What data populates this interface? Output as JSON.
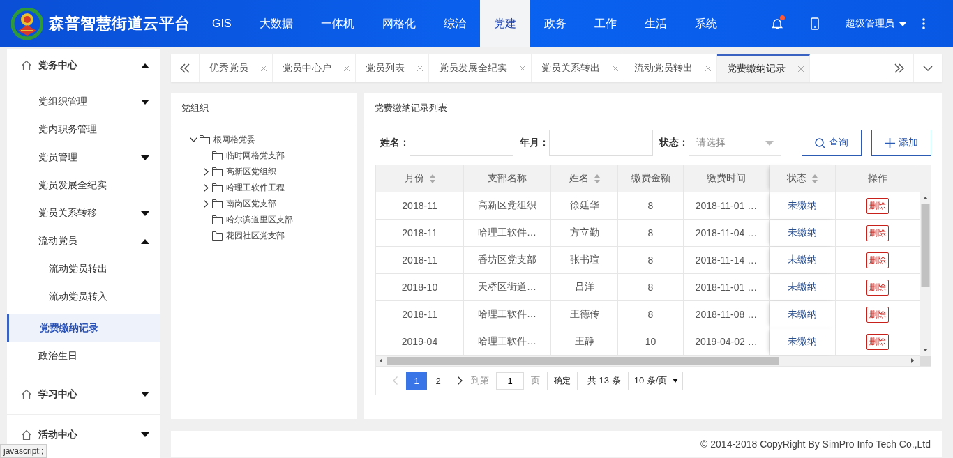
{
  "header": {
    "title": "森普智慧街道云平台",
    "nav": [
      {
        "label": "GIS",
        "selected": false
      },
      {
        "label": "大数据",
        "selected": false
      },
      {
        "label": "一体机",
        "selected": false
      },
      {
        "label": "网格化",
        "selected": false
      },
      {
        "label": "综治",
        "selected": false
      },
      {
        "label": "党建",
        "selected": true
      },
      {
        "label": "政务",
        "selected": false
      },
      {
        "label": "工作",
        "selected": false
      },
      {
        "label": "生活",
        "selected": false
      },
      {
        "label": "系统",
        "selected": false
      }
    ],
    "notifications": {
      "unread": true
    },
    "user": "超级管理员"
  },
  "sidebar": {
    "groups": [
      {
        "label": "党务中心",
        "expanded": true,
        "items": [
          {
            "label": "党组织管理",
            "kind": "submenu",
            "expanded": false,
            "selected": false
          },
          {
            "label": "党内职务管理",
            "kind": "link",
            "selected": false
          },
          {
            "label": "党员管理",
            "kind": "submenu",
            "expanded": false,
            "selected": false
          },
          {
            "label": "党员发展全纪实",
            "kind": "link",
            "selected": false
          },
          {
            "label": "党员关系转移",
            "kind": "submenu",
            "expanded": false,
            "selected": false
          },
          {
            "label": "流动党员",
            "kind": "submenu",
            "expanded": true,
            "selected": false,
            "children": [
              {
                "label": "流动党员转出",
                "selected": false
              },
              {
                "label": "流动党员转入",
                "selected": false
              }
            ]
          },
          {
            "label": "党费缴纳记录",
            "kind": "link",
            "selected": true
          },
          {
            "label": "政治生日",
            "kind": "link",
            "selected": false
          }
        ]
      },
      {
        "label": "学习中心",
        "expanded": false
      },
      {
        "label": "活动中心",
        "expanded": false
      }
    ]
  },
  "tabs": [
    {
      "label": "优秀党员",
      "selected": false
    },
    {
      "label": "党员中心户",
      "selected": false
    },
    {
      "label": "党员列表",
      "selected": false
    },
    {
      "label": "党员发展全纪实",
      "selected": false
    },
    {
      "label": "党员关系转出",
      "selected": false
    },
    {
      "label": "流动党员转出",
      "selected": false
    },
    {
      "label": "党费缴纳记录",
      "selected": true
    }
  ],
  "org_panel": {
    "title": "党组织",
    "tree": [
      {
        "label": "根网格党委",
        "kind": "branch",
        "expanded": true,
        "children": [
          {
            "label": "临时网格党支部",
            "kind": "leaf"
          },
          {
            "label": "高新区党组织",
            "kind": "branch",
            "expanded": false
          },
          {
            "label": "哈理工软件工程",
            "kind": "branch",
            "expanded": false
          },
          {
            "label": "南岗区党支部",
            "kind": "branch",
            "expanded": false
          },
          {
            "label": "哈尔滨道里区支部",
            "kind": "leaf"
          },
          {
            "label": "花园社区党支部",
            "kind": "leaf"
          }
        ]
      }
    ]
  },
  "records": {
    "title": "党费缴纳记录列表",
    "filters": [
      {
        "label": "姓名：",
        "kind": "text"
      },
      {
        "label": "年月：",
        "kind": "text"
      },
      {
        "label": "状态：",
        "kind": "select",
        "placeholder": "请选择"
      }
    ],
    "buttons": [
      {
        "label": "查询",
        "kind": "search"
      },
      {
        "label": "添加",
        "kind": "add"
      }
    ],
    "table": {
      "columns": [
        {
          "label": "月份",
          "sortable": true
        },
        {
          "label": "支部名称",
          "sortable": false
        },
        {
          "label": "姓名",
          "sortable": true
        },
        {
          "label": "缴费金额",
          "sortable": false
        },
        {
          "label": "缴费时间",
          "sortable": false
        },
        {
          "label": "状态",
          "sortable": true
        },
        {
          "label": "操作",
          "sortable": false
        }
      ],
      "rows": [
        {
          "cells": [
            "2018-11",
            "高新区党组织",
            "徐廷华",
            "8",
            "2018-11-01 …"
          ],
          "status": "未缴纳",
          "action": "删除"
        },
        {
          "cells": [
            "2018-11",
            "哈理工软件…",
            "方立勤",
            "8",
            "2018-11-04 …"
          ],
          "status": "未缴纳",
          "action": "删除"
        },
        {
          "cells": [
            "2018-11",
            "香坊区党支部",
            "张书瑄",
            "8",
            "2018-11-14 …"
          ],
          "status": "未缴纳",
          "action": "删除"
        },
        {
          "cells": [
            "2018-10",
            "天桥区街道…",
            "吕洋",
            "8",
            "2018-11-01 …"
          ],
          "status": "未缴纳",
          "action": "删除"
        },
        {
          "cells": [
            "2018-11",
            "哈理工软件…",
            "王德传",
            "8",
            "2018-11-08 …"
          ],
          "status": "未缴纳",
          "action": "删除"
        },
        {
          "cells": [
            "2019-04",
            "哈理工软件…",
            "王静",
            "10",
            "2019-04-02 …"
          ],
          "status": "未缴纳",
          "action": "删除"
        }
      ]
    },
    "pagination": {
      "pages": [
        {
          "label": "1",
          "selected": true
        },
        {
          "label": "2",
          "selected": false
        }
      ],
      "goto_label": "到第",
      "goto_value": "1",
      "page_unit": "页",
      "confirm": "确定",
      "total": "共 13 条",
      "page_size": "10 条/页"
    }
  },
  "footer": "© 2014-2018 CopyRight By SimPro Info Tech Co.,Ltd",
  "status_bar": "javascript:;"
}
